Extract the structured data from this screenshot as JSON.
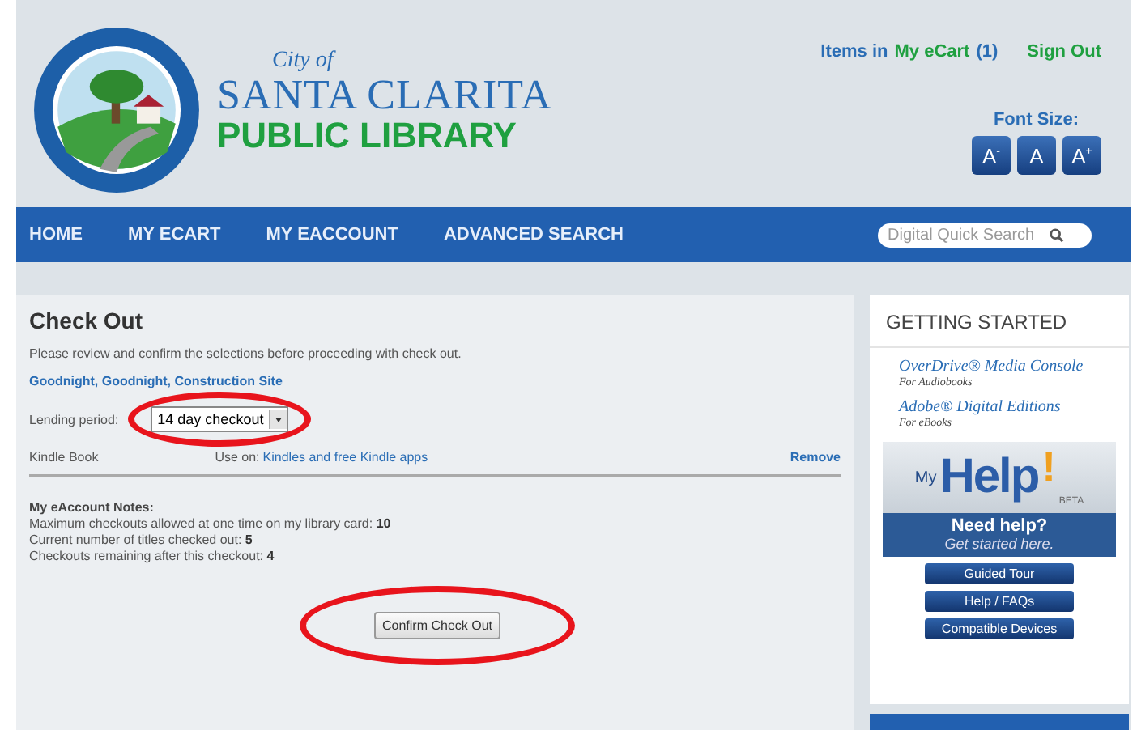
{
  "header": {
    "logo": {
      "city": "City of",
      "name": "SANTA CLARITA",
      "library": "PUBLIC LIBRARY"
    },
    "cart_label": "Items in",
    "cart_link": "My eCart",
    "cart_count": "(1)",
    "sign_out": "Sign Out",
    "font_size_label": "Font Size:",
    "font_buttons": [
      "A$^{-}$",
      "A",
      "A$^{+}$"
    ]
  },
  "nav": {
    "items": [
      "HOME",
      "MY ECART",
      "MY EACCOUNT",
      "ADVANCED SEARCH"
    ],
    "search": {
      "placeholder": "Digital Quick Search"
    }
  },
  "checkout": {
    "title": "Check Out",
    "intro": "Please review and confirm the selections before proceeding with check out.",
    "item": {
      "title": "Goodnight, Goodnight, Construction Site",
      "lending_label": "Lending period:",
      "lending_value": "14 day checkout",
      "format": "Kindle Book",
      "use_on_label": "Use on:",
      "use_on_link": "Kindles and free Kindle apps",
      "remove": "Remove"
    },
    "notes_title": "My eAccount Notes:",
    "notes": [
      "Maximum checkouts allowed at one time on my library card: **10**",
      "Current number of titles checked out: **5**",
      "Checkouts remaining after this checkout: **4**"
    ],
    "confirm": "Confirm Check Out"
  },
  "sidebar": {
    "title": "GETTING STARTED",
    "links": [
      {
        "name": "OverDrive® Media Console",
        "sub": "For Audiobooks"
      },
      {
        "name": "Adobe® Digital Editions",
        "sub": "For eBooks"
      }
    ],
    "help": {
      "my": "My",
      "help": "Help",
      "bang": "!",
      "beta": "BETA",
      "need": "Need help?",
      "started": "Get started here.",
      "buttons": [
        "Guided Tour",
        "Help / FAQs",
        "Compatible Devices"
      ]
    }
  }
}
